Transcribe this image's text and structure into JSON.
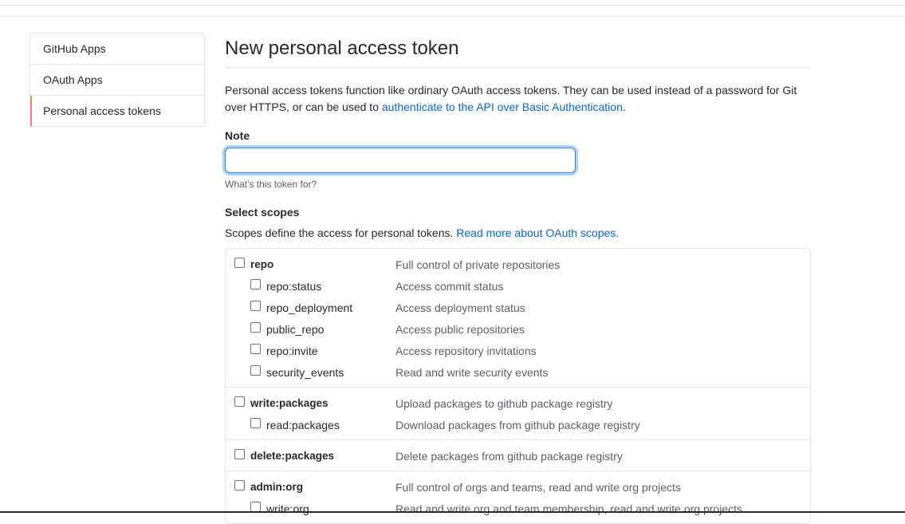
{
  "sidebar": {
    "items": [
      {
        "label": "GitHub Apps"
      },
      {
        "label": "OAuth Apps"
      },
      {
        "label": "Personal access tokens"
      }
    ]
  },
  "main": {
    "title": "New personal access token",
    "intro_text": "Personal access tokens function like ordinary OAuth access tokens. They can be used instead of a password for Git over HTTPS, or can be used to ",
    "intro_link": "authenticate to the API over Basic Authentication",
    "intro_end": ".",
    "note_label": "Note",
    "note_value": "",
    "note_hint": "What’s this token for?",
    "scopes_label": "Select scopes",
    "scopes_desc_text": "Scopes define the access for personal tokens. ",
    "scopes_desc_link": "Read more about OAuth scopes."
  },
  "scopes": {
    "repo": {
      "name": "repo",
      "desc": "Full control of private repositories"
    },
    "repo_status": {
      "name": "repo:status",
      "desc": "Access commit status"
    },
    "repo_deployment": {
      "name": "repo_deployment",
      "desc": "Access deployment status"
    },
    "public_repo": {
      "name": "public_repo",
      "desc": "Access public repositories"
    },
    "repo_invite": {
      "name": "repo:invite",
      "desc": "Access repository invitations"
    },
    "security_events": {
      "name": "security_events",
      "desc": "Read and write security events"
    },
    "write_packages": {
      "name": "write:packages",
      "desc": "Upload packages to github package registry"
    },
    "read_packages": {
      "name": "read:packages",
      "desc": "Download packages from github package registry"
    },
    "delete_packages": {
      "name": "delete:packages",
      "desc": "Delete packages from github package registry"
    },
    "admin_org": {
      "name": "admin:org",
      "desc": "Full control of orgs and teams, read and write org projects"
    },
    "write_org": {
      "name": "write:org",
      "desc": "Read and write org and team membership, read and write org projects"
    }
  }
}
